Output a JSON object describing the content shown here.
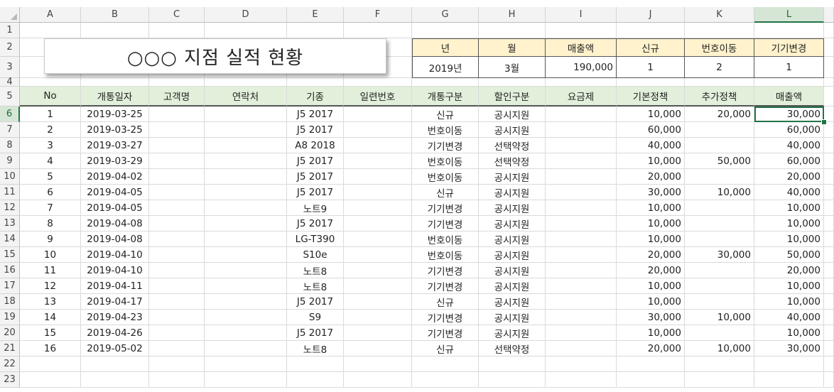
{
  "columns": [
    "A",
    "B",
    "C",
    "D",
    "E",
    "F",
    "G",
    "H",
    "I",
    "J",
    "K",
    "L"
  ],
  "selected_column": "L",
  "selected_row": 6,
  "rows": [
    "1",
    "2",
    "3",
    "4",
    "5",
    "6",
    "7",
    "8",
    "9",
    "10",
    "11",
    "12",
    "13",
    "14",
    "15",
    "16",
    "17",
    "18",
    "19",
    "20",
    "21",
    "22",
    "23"
  ],
  "title": "○○○ 지점  실적 현황",
  "summary": {
    "headers": [
      "년",
      "월",
      "매출액",
      "신규",
      "번호이동",
      "기기변경"
    ],
    "values": [
      "2019년",
      "3월",
      "190,000",
      "1",
      "2",
      "1"
    ]
  },
  "table": {
    "headers": [
      "No",
      "개통일자",
      "고객명",
      "연락처",
      "기종",
      "일련번호",
      "개통구분",
      "할인구분",
      "요금제",
      "기본정책",
      "추가정책",
      "매출액"
    ],
    "rows": [
      [
        "1",
        "2019-03-25",
        "",
        "",
        "J5 2017",
        "",
        "신규",
        "공시지원",
        "",
        "10,000",
        "20,000",
        "30,000"
      ],
      [
        "2",
        "2019-03-25",
        "",
        "",
        "J5 2017",
        "",
        "번호이동",
        "공시지원",
        "",
        "60,000",
        "",
        "60,000"
      ],
      [
        "3",
        "2019-03-27",
        "",
        "",
        "A8 2018",
        "",
        "기기변경",
        "선택약정",
        "",
        "40,000",
        "",
        "40,000"
      ],
      [
        "4",
        "2019-03-29",
        "",
        "",
        "J5 2017",
        "",
        "번호이동",
        "선택약정",
        "",
        "10,000",
        "50,000",
        "60,000"
      ],
      [
        "5",
        "2019-04-02",
        "",
        "",
        "J5 2017",
        "",
        "번호이동",
        "공시지원",
        "",
        "20,000",
        "",
        "20,000"
      ],
      [
        "6",
        "2019-04-05",
        "",
        "",
        "J5 2017",
        "",
        "신규",
        "공시지원",
        "",
        "30,000",
        "10,000",
        "40,000"
      ],
      [
        "7",
        "2019-04-05",
        "",
        "",
        "노트9",
        "",
        "기기변경",
        "공시지원",
        "",
        "10,000",
        "",
        "10,000"
      ],
      [
        "8",
        "2019-04-08",
        "",
        "",
        "J5 2017",
        "",
        "기기변경",
        "공시지원",
        "",
        "10,000",
        "",
        "10,000"
      ],
      [
        "9",
        "2019-04-08",
        "",
        "",
        "LG-T390",
        "",
        "번호이동",
        "공시지원",
        "",
        "10,000",
        "",
        "10,000"
      ],
      [
        "10",
        "2019-04-10",
        "",
        "",
        "S10e",
        "",
        "번호이동",
        "공시지원",
        "",
        "20,000",
        "30,000",
        "50,000"
      ],
      [
        "11",
        "2019-04-10",
        "",
        "",
        "노트8",
        "",
        "기기변경",
        "공시지원",
        "",
        "20,000",
        "",
        "20,000"
      ],
      [
        "12",
        "2019-04-11",
        "",
        "",
        "노트8",
        "",
        "기기변경",
        "공시지원",
        "",
        "10,000",
        "",
        "10,000"
      ],
      [
        "13",
        "2019-04-17",
        "",
        "",
        "J5 2017",
        "",
        "신규",
        "공시지원",
        "",
        "10,000",
        "",
        "10,000"
      ],
      [
        "14",
        "2019-04-23",
        "",
        "",
        "S9",
        "",
        "기기변경",
        "공시지원",
        "",
        "30,000",
        "10,000",
        "40,000"
      ],
      [
        "15",
        "2019-04-26",
        "",
        "",
        "J5 2017",
        "",
        "기기변경",
        "공시지원",
        "",
        "10,000",
        "",
        "10,000"
      ],
      [
        "16",
        "2019-05-02",
        "",
        "",
        "노트8",
        "",
        "신규",
        "선택약정",
        "",
        "20,000",
        "10,000",
        "30,000"
      ]
    ]
  },
  "colors": {
    "header_green": "#e2efda",
    "header_yellow": "#fff2cc",
    "selection": "#217346"
  }
}
